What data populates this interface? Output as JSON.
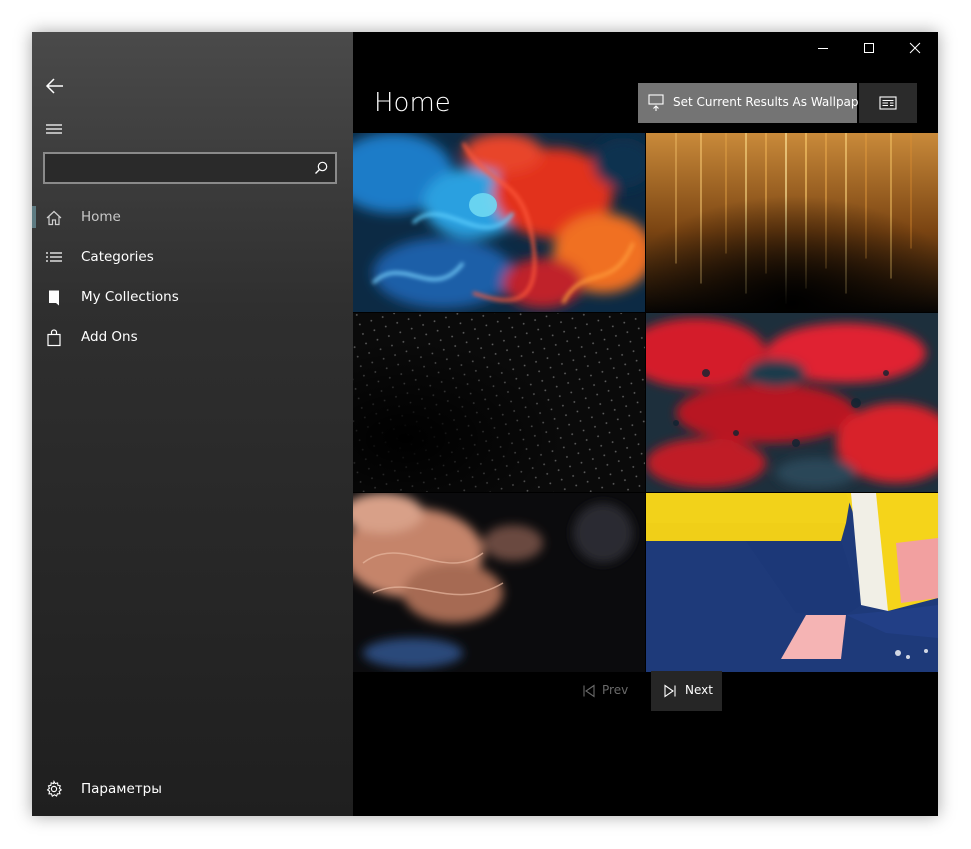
{
  "sidebar": {
    "search": {
      "value": "",
      "placeholder": ""
    },
    "items": [
      {
        "label": "Home",
        "icon": "home-icon"
      },
      {
        "label": "Categories",
        "icon": "list-icon"
      },
      {
        "label": "My Collections",
        "icon": "collection-icon"
      },
      {
        "label": "Add Ons",
        "icon": "shopping-bag-icon"
      }
    ],
    "settings_label": "Параметры"
  },
  "main": {
    "title": "Home",
    "set_wallpaper_label": "Set Current Results As Wallpaper",
    "tiles": [
      {
        "description_icon": "wallpaper-thumbnail",
        "colors": [
          "#1a4f7a",
          "#e23b2a"
        ]
      },
      {
        "description_icon": "wallpaper-thumbnail",
        "colors": [
          "#3a1d05",
          "#d98a2a"
        ]
      },
      {
        "description_icon": "wallpaper-thumbnail",
        "colors": [
          "#0a0a0a",
          "#6a6a6a"
        ]
      },
      {
        "description_icon": "wallpaper-thumbnail",
        "colors": [
          "#1a2e3a",
          "#d8202a"
        ]
      },
      {
        "description_icon": "wallpaper-thumbnail",
        "colors": [
          "#0d0d0d",
          "#c9876a"
        ]
      },
      {
        "description_icon": "wallpaper-thumbnail",
        "colors": [
          "#1d3b7a",
          "#f2d21a"
        ]
      }
    ],
    "pager": {
      "prev_label": "Prev",
      "next_label": "Next"
    }
  },
  "colors": {
    "accent": "#5e7b82",
    "sidebar_top": "#4a4a4a",
    "sidebar_bottom": "#1f1f1f",
    "button_gray": "#747474"
  }
}
